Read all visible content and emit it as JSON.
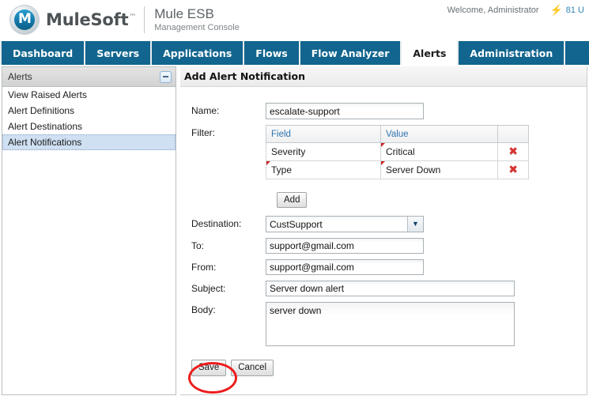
{
  "header": {
    "brand_name": "MuleSoft",
    "brand_tm": "™",
    "logo_letter": "M",
    "product_name": "Mule ESB",
    "product_sub": "Management Console",
    "welcome": "Welcome, Administrator",
    "bolt_icon": "⚡",
    "user_count": "81 U"
  },
  "tabs": [
    {
      "label": "Dashboard",
      "active": false
    },
    {
      "label": "Servers",
      "active": false
    },
    {
      "label": "Applications",
      "active": false
    },
    {
      "label": "Flows",
      "active": false
    },
    {
      "label": "Flow Analyzer",
      "active": false
    },
    {
      "label": "Alerts",
      "active": true
    },
    {
      "label": "Administration",
      "active": false
    }
  ],
  "sidebar": {
    "title": "Alerts",
    "collapse_icon": "minus-icon",
    "items": [
      {
        "label": "View Raised Alerts",
        "selected": false
      },
      {
        "label": "Alert Definitions",
        "selected": false
      },
      {
        "label": "Alert Destinations",
        "selected": false
      },
      {
        "label": "Alert Notifications",
        "selected": true
      }
    ]
  },
  "main": {
    "title": "Add Alert Notification",
    "labels": {
      "name": "Name:",
      "filter": "Filter:",
      "destination": "Destination:",
      "to": "To:",
      "from": "From:",
      "subject": "Subject:",
      "body": "Body:"
    },
    "fields": {
      "name_value": "escalate-support",
      "name_placeholder": "",
      "destination_value": "CustSupport",
      "to_value": "support@gmail.com",
      "to_placeholder": "",
      "from_value": "support@gmail.com",
      "from_placeholder": "",
      "subject_value": "Server down alert",
      "subject_placeholder": "",
      "body_value": "server down",
      "body_placeholder": ""
    },
    "filter_table": {
      "columns": [
        "Field",
        "Value",
        ""
      ],
      "rows": [
        {
          "field": "Severity",
          "value": "Critical",
          "delete_icon": "delete-x-icon"
        },
        {
          "field": "Type",
          "value": "Server Down",
          "delete_icon": "delete-x-icon"
        }
      ]
    },
    "buttons": {
      "add": "Add",
      "save": "Save",
      "cancel": "Cancel"
    },
    "select_arrow": "▼"
  },
  "annotation": {
    "shape": "ellipse",
    "color": "#ee1c1c",
    "target": "save-button"
  },
  "colors": {
    "tab_bar": "#12658e",
    "tab_active_bg": "#ffffff",
    "link_blue": "#2f74ad",
    "delete_red": "#d8332f",
    "annotation_red": "#ee1c1c",
    "sidebar_selected": "#cfe0f2"
  }
}
